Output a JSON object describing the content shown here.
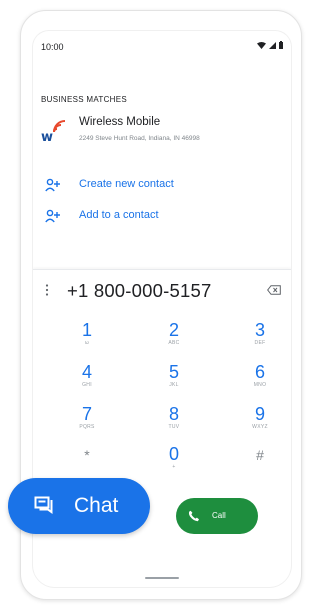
{
  "status_bar": {
    "time": "10:00"
  },
  "section_title": "BUSINESS MATCHES",
  "business": {
    "name": "Wireless Mobile",
    "address": "2249 Steve Hunt Road, Indiana, IN 46998"
  },
  "actions": {
    "create_contact": "Create new contact",
    "add_to_contact": "Add to a contact"
  },
  "dialer": {
    "number": "+1 800-000-5157",
    "keys": [
      {
        "digit": "1",
        "letters": "ω"
      },
      {
        "digit": "2",
        "letters": "ABC"
      },
      {
        "digit": "3",
        "letters": "DEF"
      },
      {
        "digit": "4",
        "letters": "GHI"
      },
      {
        "digit": "5",
        "letters": "JKL"
      },
      {
        "digit": "6",
        "letters": "MNO"
      },
      {
        "digit": "7",
        "letters": "PQRS"
      },
      {
        "digit": "8",
        "letters": "TUV"
      },
      {
        "digit": "9",
        "letters": "WXYZ"
      },
      {
        "digit": "*",
        "letters": ""
      },
      {
        "digit": "0",
        "letters": "+"
      },
      {
        "digit": "#",
        "letters": ""
      }
    ],
    "call_label": "Call"
  },
  "chat_button": {
    "label": "Chat"
  },
  "icons": {
    "business_logo": "wireless-logo-icon",
    "create_contact": "person-add-icon",
    "add_contact": "person-add-icon",
    "menu": "more-vert-icon",
    "backspace": "backspace-icon",
    "call": "phone-icon",
    "chat": "chat-icon"
  },
  "colors": {
    "accent": "#1a73e8",
    "call": "#1e8e3e",
    "text": "#202124",
    "secondary": "#80868b"
  }
}
